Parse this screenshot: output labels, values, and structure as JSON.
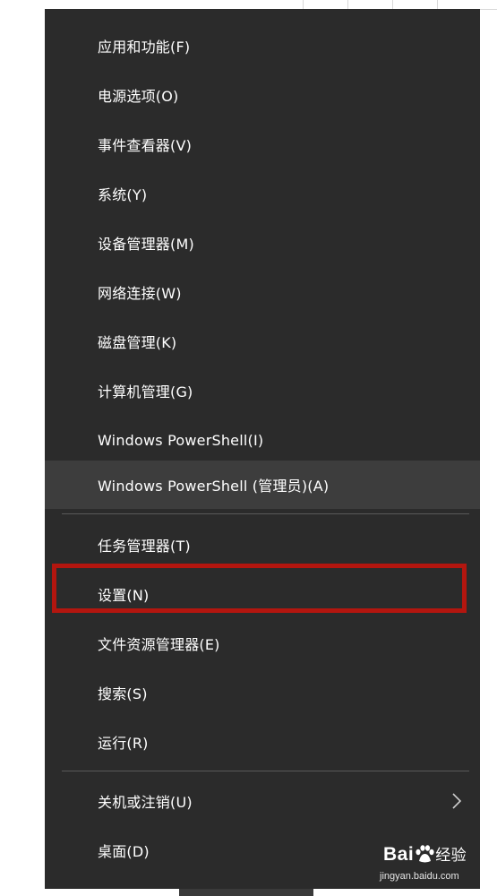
{
  "menu": {
    "items": [
      {
        "label": "应用和功能(F)"
      },
      {
        "label": "电源选项(O)"
      },
      {
        "label": "事件查看器(V)"
      },
      {
        "label": "系统(Y)"
      },
      {
        "label": "设备管理器(M)"
      },
      {
        "label": "网络连接(W)"
      },
      {
        "label": "磁盘管理(K)"
      },
      {
        "label": "计算机管理(G)"
      },
      {
        "label": "Windows PowerShell(I)"
      },
      {
        "label": "Windows PowerShell (管理员)(A)"
      },
      {
        "label": "任务管理器(T)"
      },
      {
        "label": "设置(N)"
      },
      {
        "label": "文件资源管理器(E)"
      },
      {
        "label": "搜索(S)"
      },
      {
        "label": "运行(R)"
      },
      {
        "label": "关机或注销(U)"
      },
      {
        "label": "桌面(D)"
      }
    ],
    "hovered_item": "Windows PowerShell (管理员)(A)",
    "highlighted_item": "设置(N)",
    "submenu_icon": "chevron-right-icon"
  },
  "watermark": {
    "brand_left": "Bai",
    "brand_right": "经验",
    "url": "jingyan.baidu.com",
    "icon": "baidu-paw-icon"
  },
  "colors": {
    "menu_background": "#2b2b2b",
    "hover_background": "#3d3d3d",
    "text": "#ffffff",
    "separator": "#5a5a5a",
    "highlight_border": "#b3160f"
  }
}
